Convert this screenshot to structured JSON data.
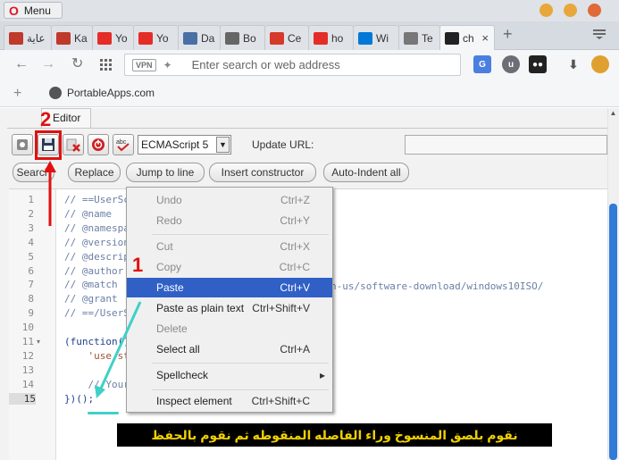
{
  "browser": {
    "menu_label": "Menu",
    "tabs": [
      {
        "label": "عاية",
        "icon": "house-icon",
        "color": "#c0392b"
      },
      {
        "label": "Ka",
        "icon": "house-icon",
        "color": "#c0392b"
      },
      {
        "label": "Yo",
        "icon": "youtube-icon",
        "color": "#e52d27"
      },
      {
        "label": "Yo",
        "icon": "youtube-icon",
        "color": "#e52d27"
      },
      {
        "label": "Da",
        "icon": "document-icon",
        "color": "#4a6fa5"
      },
      {
        "label": "Bo",
        "icon": "heart-icon",
        "color": "#666666"
      },
      {
        "label": "Ce",
        "icon": "car-icon",
        "color": "#d63a2a"
      },
      {
        "label": "ho",
        "icon": "youtube-icon",
        "color": "#e52d27"
      },
      {
        "label": "Wi",
        "icon": "windows-icon",
        "color": "#0078d7"
      },
      {
        "label": "Te",
        "icon": "page-icon",
        "color": "#777777"
      },
      {
        "label": "ch",
        "icon": "tampermonkey-icon",
        "color": "#222222",
        "active": true
      }
    ],
    "address_placeholder": "Enter search or web address",
    "vpn_label": "VPN",
    "bookmark_label": "PortableApps.com"
  },
  "editor": {
    "tab_label": "Editor",
    "language": "ECMAScript 5",
    "update_url_label": "Update URL:",
    "buttons": [
      "Search",
      "Replace",
      "Jump to line",
      "Insert constructor",
      "Auto-Indent all"
    ],
    "line_numbers": [
      "1",
      "2",
      "3",
      "4",
      "5",
      "6",
      "7",
      "8",
      "9",
      "10",
      "11",
      "12",
      "13",
      "14",
      "15"
    ],
    "code_lines": [
      "// ==UserSc",
      "// @name",
      "// @namespa",
      "// @version",
      "// @descrip",
      "// @author",
      "// @match",
      "// @grant",
      "// ==/UserS",
      "",
      "(function()",
      "    'use st",
      "",
      "    // Your",
      "})();"
    ],
    "match_url_tail": "n-us/software-download/windows10ISO/"
  },
  "context_menu": {
    "items": [
      {
        "label": "Undo",
        "shortcut": "Ctrl+Z",
        "disabled": true
      },
      {
        "label": "Redo",
        "shortcut": "Ctrl+Y",
        "disabled": true
      },
      {
        "label": "Cut",
        "shortcut": "Ctrl+X",
        "disabled": true
      },
      {
        "label": "Copy",
        "shortcut": "Ctrl+C",
        "disabled": true
      },
      {
        "label": "Paste",
        "shortcut": "Ctrl+V",
        "highlighted": true
      },
      {
        "label": "Paste as plain text",
        "shortcut": "Ctrl+Shift+V"
      },
      {
        "label": "Delete",
        "shortcut": "",
        "disabled": true
      },
      {
        "label": "Select all",
        "shortcut": "Ctrl+A"
      },
      {
        "label": "Spellcheck",
        "shortcut": "▸"
      },
      {
        "label": "Inspect element",
        "shortcut": "Ctrl+Shift+C"
      }
    ]
  },
  "annotations": {
    "step1": "1",
    "step2": "2",
    "caption": "نقوم بلصق المنسوخ وراء الفاصله المنقوطه ثم نقوم بالحفظ",
    "color": "#e01010",
    "arrow_color": "#3fd0c8"
  }
}
